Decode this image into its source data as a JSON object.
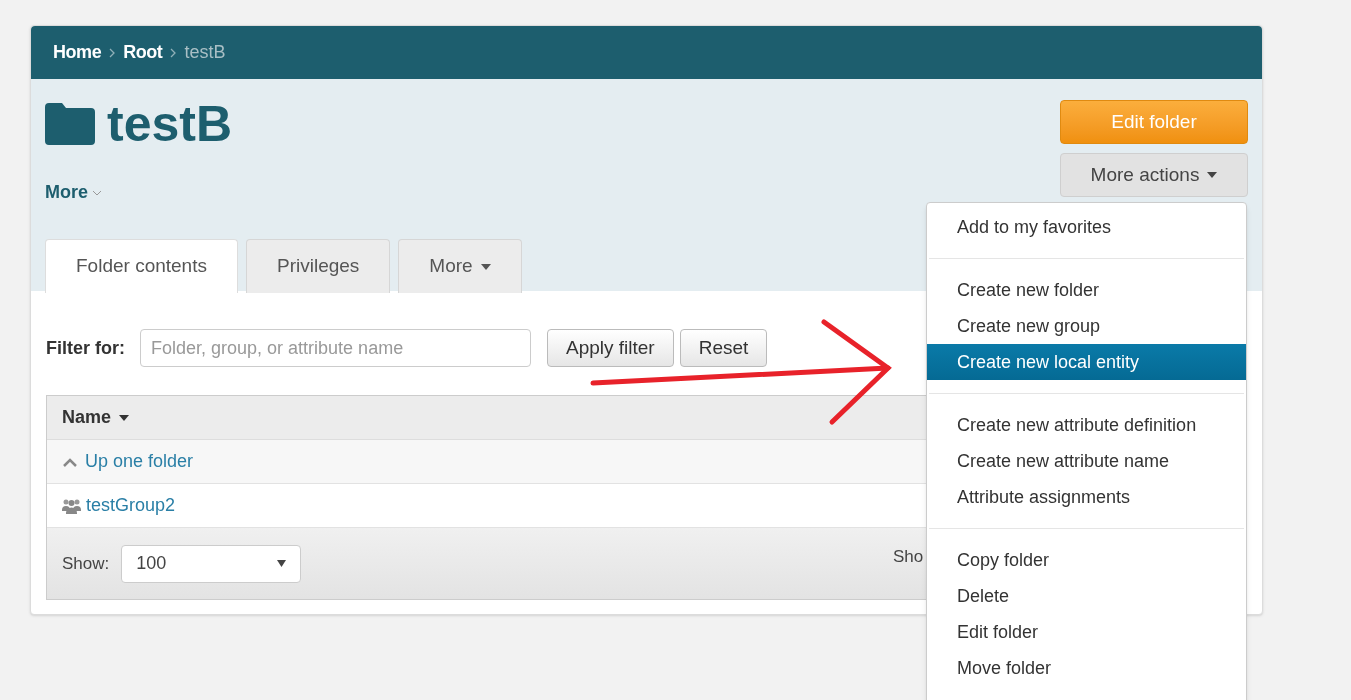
{
  "breadcrumb": [
    {
      "label": "Home",
      "current": false
    },
    {
      "label": "Root",
      "current": false
    },
    {
      "label": "testB",
      "current": true
    }
  ],
  "title": "testB",
  "more_link": "More",
  "buttons": {
    "edit": "Edit folder",
    "more_actions": "More actions"
  },
  "tabs": [
    {
      "label": "Folder contents",
      "selected": true,
      "dropdown": false
    },
    {
      "label": "Privileges",
      "selected": false,
      "dropdown": false
    },
    {
      "label": "More",
      "selected": false,
      "dropdown": true
    }
  ],
  "filter": {
    "label": "Filter for:",
    "placeholder": "Folder, group, or attribute name",
    "apply": "Apply filter",
    "reset": "Reset"
  },
  "table": {
    "column": "Name",
    "rows": [
      {
        "kind": "up",
        "label": "Up one folder"
      },
      {
        "kind": "group",
        "label": "testGroup2"
      }
    ]
  },
  "footer": {
    "show_label": "Show:",
    "show_value": "100",
    "right_text": "Sho"
  },
  "menu": [
    [
      {
        "label": "Add to my favorites",
        "selected": false
      }
    ],
    [
      {
        "label": "Create new folder",
        "selected": false
      },
      {
        "label": "Create new group",
        "selected": false
      },
      {
        "label": "Create new local entity",
        "selected": true
      }
    ],
    [
      {
        "label": "Create new attribute definition",
        "selected": false
      },
      {
        "label": "Create new attribute name",
        "selected": false
      },
      {
        "label": "Attribute assignments",
        "selected": false
      }
    ],
    [
      {
        "label": "Copy folder",
        "selected": false
      },
      {
        "label": "Delete",
        "selected": false
      },
      {
        "label": "Edit folder",
        "selected": false
      },
      {
        "label": "Move folder",
        "selected": false
      }
    ]
  ]
}
